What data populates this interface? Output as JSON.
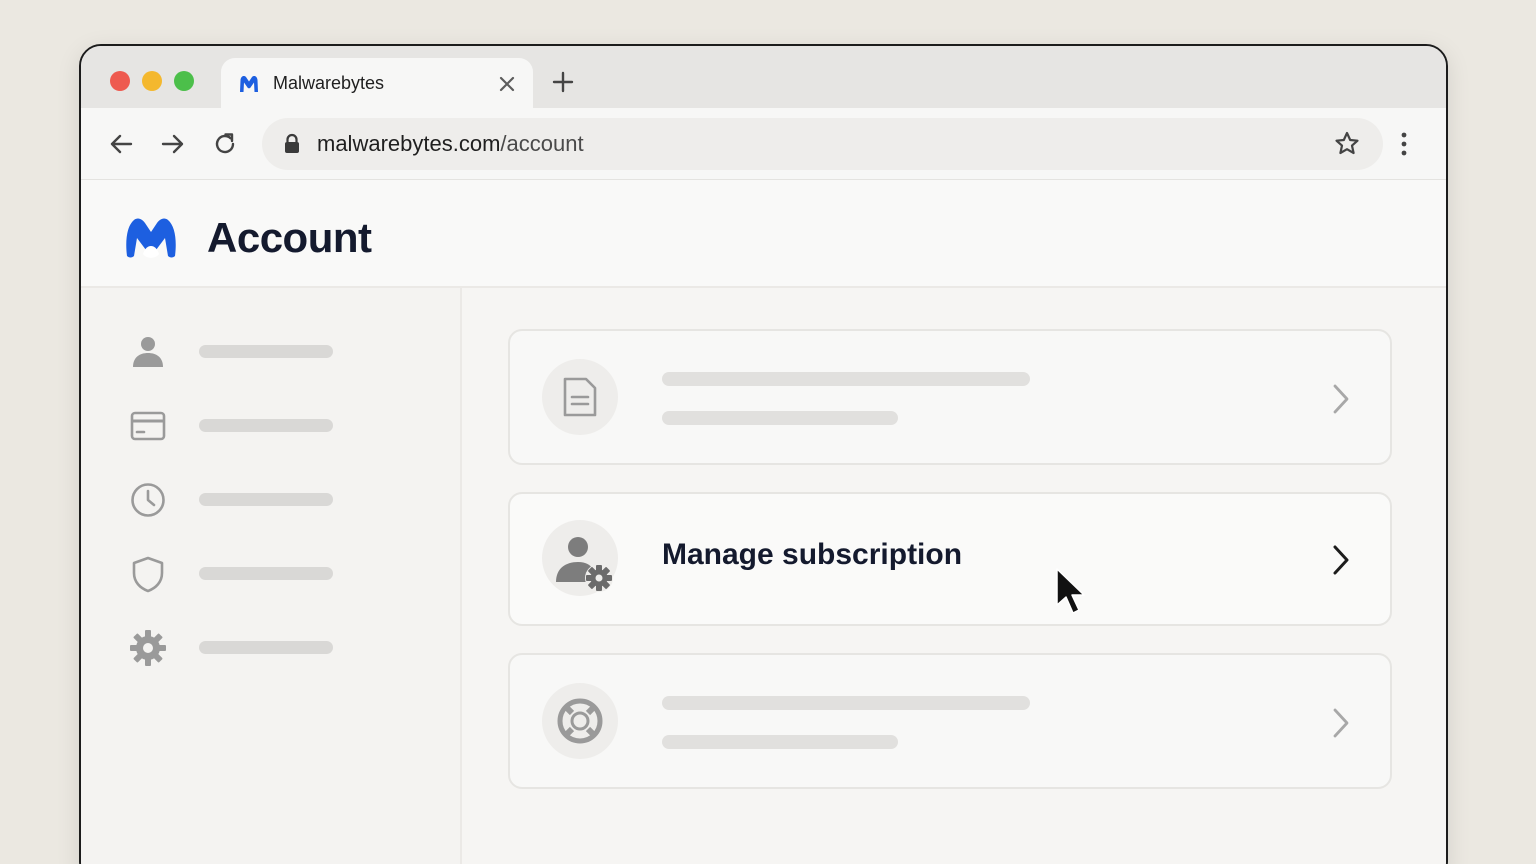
{
  "browser": {
    "tab": {
      "title": "Malwarebytes",
      "logo_icon": "malwarebytes-logo-icon",
      "close_icon": "close-icon"
    },
    "new_tab_icon": "plus-icon",
    "toolbar": {
      "back_icon": "arrow-left-icon",
      "forward_icon": "arrow-right-icon",
      "reload_icon": "reload-icon",
      "url_host": "malwarebytes.com",
      "url_path": "/account",
      "lock_icon": "lock-icon",
      "bookmark_icon": "star-icon",
      "menu_icon": "more-vertical-icon"
    }
  },
  "header": {
    "title": "Account",
    "brand_color": "#1d5fe0"
  },
  "sidebar": {
    "items": [
      {
        "icon": "user-icon"
      },
      {
        "icon": "credit-card-icon"
      },
      {
        "icon": "clock-icon"
      },
      {
        "icon": "shield-icon"
      },
      {
        "icon": "gear-icon"
      }
    ]
  },
  "main": {
    "cards": [
      {
        "icon": "document-icon"
      },
      {
        "icon": "user-gear-icon",
        "label": "Manage subscription"
      },
      {
        "icon": "lifebuoy-icon"
      }
    ]
  }
}
